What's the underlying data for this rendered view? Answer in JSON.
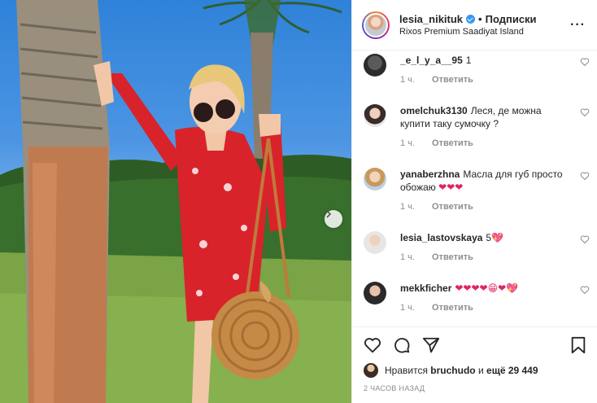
{
  "post": {
    "username": "lesia_nikituk",
    "follow_label": "Подписки",
    "location": "Rixos Premium Saadiyat Island",
    "more_label": "···"
  },
  "comments": [
    {
      "user": "_e_l_y_a__95",
      "text": "1",
      "time": "1 ч.",
      "reply": "Ответить"
    },
    {
      "user": "omelchuk3130",
      "text": "Леся, де можна купити таку сумочку ?",
      "time": "1 ч.",
      "reply": "Ответить"
    },
    {
      "user": "yanaberzhna",
      "text": "Масла для губ просто обожаю",
      "emoji": "❤❤❤",
      "time": "1 ч.",
      "reply": "Ответить"
    },
    {
      "user": "lesia_lastovskaya",
      "text": "5",
      "emoji": "💖",
      "time": "1 ч.",
      "reply": "Ответить"
    },
    {
      "user": "mekkficher",
      "text": "",
      "emoji": "❤❤❤❤😁❤💖",
      "time": "1 ч.",
      "reply": "Ответить"
    }
  ],
  "likes": {
    "prefix": "Нравится",
    "user": "bruchudo",
    "middle": "и",
    "count": "ещё 29 449"
  },
  "timestamp": "2 ЧАСОВ НАЗАД",
  "icons": {
    "like": "heart-icon",
    "comment": "comment-icon",
    "share": "share-icon",
    "save": "bookmark-icon",
    "next": "chevron-right-icon"
  },
  "colors": {
    "accent": "#3897f0",
    "heart": "#e0245e",
    "meta": "#8e8e8e"
  }
}
